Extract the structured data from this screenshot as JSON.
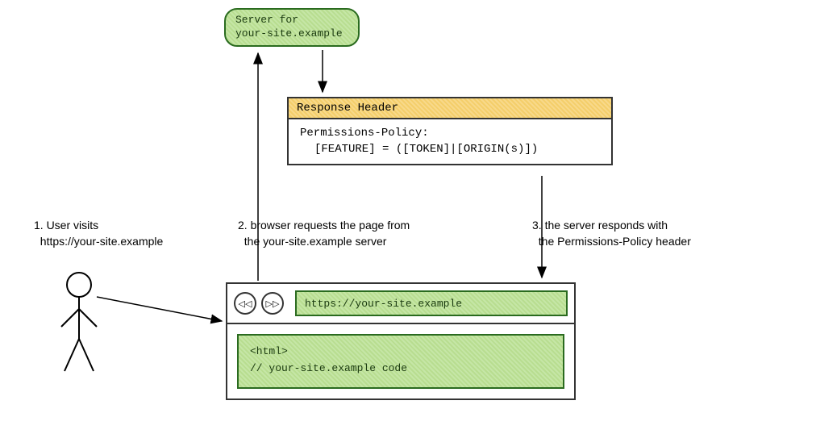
{
  "server": {
    "line1": "Server for",
    "line2": "your-site.example"
  },
  "response": {
    "title": "Response Header",
    "line1": "Permissions-Policy:",
    "line2": "[FEATURE] = ([TOKEN]|[ORIGIN(s)])"
  },
  "browser": {
    "back_glyph": "◁◁",
    "forward_glyph": "▷▷",
    "url": "https://your-site.example",
    "code_line1": "<html>",
    "code_line2": "// your-site.example code"
  },
  "steps": {
    "s1_line1": "1. User visits",
    "s1_line2": "https://your-site.example",
    "s2_line1": "2. browser requests the page from",
    "s2_line2": "the your-site.example server",
    "s3_line1": "3. the server responds with",
    "s3_line2": "the Permissions-Policy header"
  }
}
